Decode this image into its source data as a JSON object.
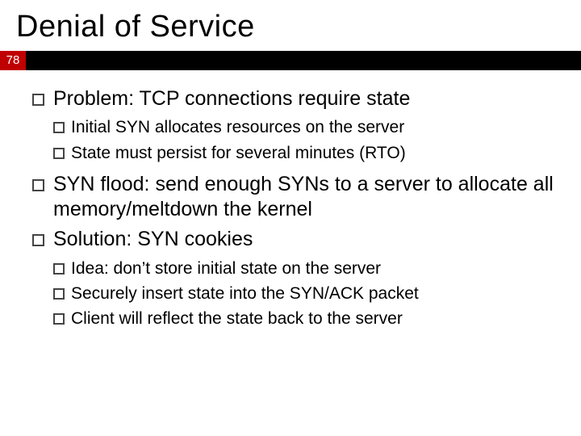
{
  "title": "Denial of Service",
  "page": "78",
  "bullets": [
    {
      "text": "Problem: TCP connections require state",
      "sub": [
        "Initial SYN allocates resources on the server",
        "State must persist for several minutes (RTO)"
      ]
    },
    {
      "text": "SYN flood: send enough SYNs to a server to allocate all memory/meltdown the kernel"
    },
    {
      "text": "Solution: SYN cookies",
      "sub": [
        "Idea: don’t store initial state on the server",
        "Securely insert state into the SYN/ACK packet",
        "Client will reflect the state back to the server"
      ]
    }
  ]
}
